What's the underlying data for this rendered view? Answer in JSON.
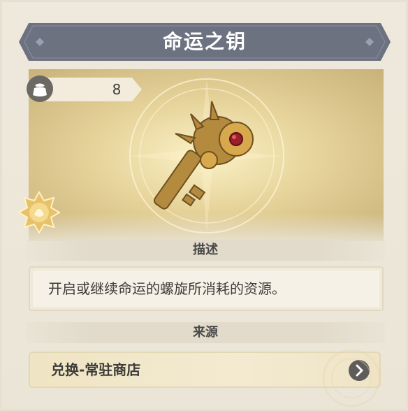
{
  "item": {
    "title": "命运之钥",
    "count": "8",
    "description_header": "描述",
    "description": "开启或继续命运的螺旋所消耗的资源。",
    "source_header": "来源",
    "source": "兑换-常驻商店"
  },
  "icons": {
    "bag": "pouch-icon",
    "rarity": "rarity-badge-icon",
    "key": "key-illustration",
    "chevron": "chevron-right-icon"
  },
  "colors": {
    "banner": "#6d7281",
    "accent_gold": "#d9b45a",
    "text_dark": "#3d3c3a"
  }
}
